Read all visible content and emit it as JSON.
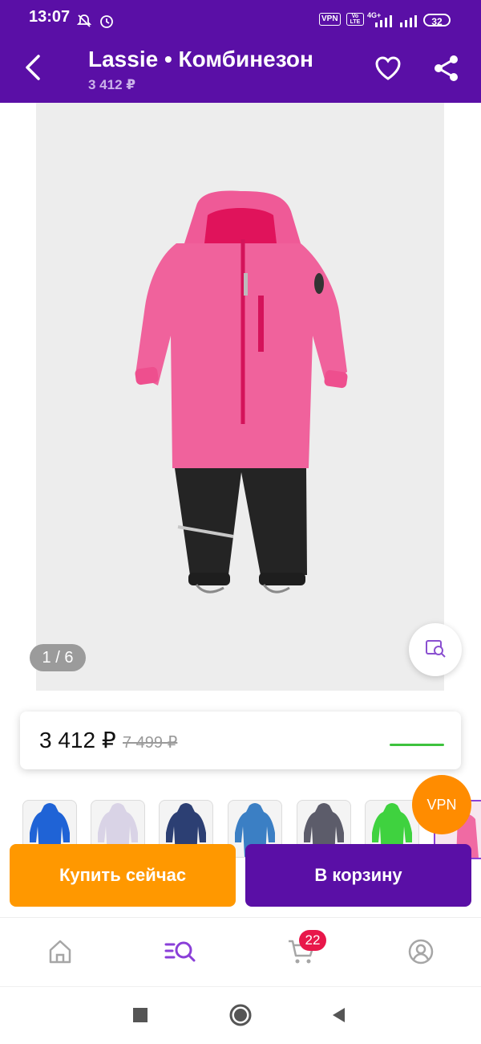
{
  "status_bar": {
    "time": "13:07",
    "vpn_label": "VPN",
    "volte_label": "Vo LTE",
    "network_label": "4G+",
    "battery": "32"
  },
  "app_bar": {
    "title": "Lassie • Комбинезон",
    "subtitle_price": "3 412 ₽",
    "icons": [
      "back-arrow-icon",
      "heart-icon",
      "share-icon"
    ]
  },
  "gallery": {
    "counter": "1 / 6",
    "image_count": 6,
    "current_index": 1
  },
  "price": {
    "current": "3 412 ₽",
    "old": "7 499 ₽",
    "accent_color": "#3ec23e"
  },
  "variants": {
    "colors": [
      "#1f63d6",
      "#d9d3e6",
      "#2c3f73",
      "#3b7fc4",
      "#5c5c6a",
      "#3fd23f"
    ]
  },
  "vpn_bubble": "VPN",
  "actions": {
    "buy_now": "Купить сейчас",
    "add_to_cart": "В корзину"
  },
  "tab_bar": {
    "items": [
      "home-icon",
      "catalog-search-icon",
      "cart-icon",
      "profile-icon"
    ],
    "cart_badge": "22"
  },
  "colors": {
    "brand_purple": "#5a0fa6",
    "buy_orange": "#ff9800",
    "badge_red": "#e8174a"
  }
}
